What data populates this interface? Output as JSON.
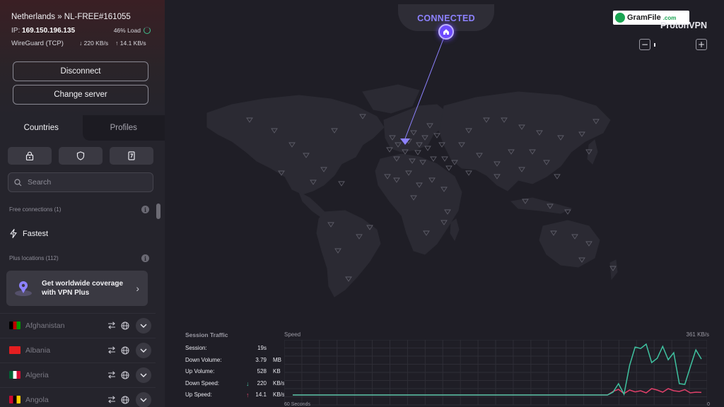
{
  "connection": {
    "server": "Netherlands » NL-FREE#161055",
    "ip_label": "IP:",
    "ip": "169.150.196.135",
    "load": "46% Load",
    "protocol": "WireGuard (TCP)",
    "down_rate": "220 KB/s",
    "up_rate": "14.1 KB/s",
    "disconnect_label": "Disconnect",
    "change_server_label": "Change server"
  },
  "tabs": [
    {
      "label": "Countries",
      "active": true
    },
    {
      "label": "Profiles",
      "active": false
    }
  ],
  "filters": [
    "lock-icon",
    "shield-icon",
    "p2p-icon"
  ],
  "search": {
    "placeholder": "Search"
  },
  "free_section": {
    "label": "Free connections (1)"
  },
  "fastest": {
    "label": "Fastest"
  },
  "plus_section": {
    "label": "Plus locations (112)"
  },
  "upsell": {
    "text": "Get worldwide coverage with VPN Plus"
  },
  "countries": [
    {
      "name": "Afghanistan",
      "flag_colors": [
        "#000000",
        "#be0000",
        "#009900"
      ]
    },
    {
      "name": "Albania",
      "flag_colors": [
        "#e41e20",
        "#e41e20",
        "#e41e20"
      ]
    },
    {
      "name": "Algeria",
      "flag_colors": [
        "#006233",
        "#ffffff",
        "#d21034"
      ]
    },
    {
      "name": "Angola",
      "flag_colors": [
        "#cc092f",
        "#000000",
        "#ffcb00"
      ]
    }
  ],
  "map": {
    "status": "CONNECTED",
    "brand": "ProtonVPN",
    "watermark_name": "GramFile",
    "watermark_domain": ".com",
    "accent": "#6d4aff"
  },
  "traffic": {
    "title": "Session Traffic",
    "stats": [
      {
        "label": "Session:",
        "value": "19s",
        "unit": "",
        "arrow": ""
      },
      {
        "label": "Down Volume:",
        "value": "3.79",
        "unit": "MB",
        "arrow": ""
      },
      {
        "label": "Up Volume:",
        "value": "528",
        "unit": "KB",
        "arrow": ""
      },
      {
        "label": "Down Speed:",
        "value": "220",
        "unit": "KB/s",
        "arrow": "↓"
      },
      {
        "label": "Up Speed:",
        "value": "14.1",
        "unit": "KB/s",
        "arrow": "↑"
      }
    ],
    "speed_label": "Speed",
    "speed_max": "361 KB/s",
    "x_left": "60 Seconds",
    "x_right": "0",
    "down_color": "#3fc2a0",
    "up_color": "#e0406a",
    "down_series": [
      0,
      0,
      0,
      0,
      0,
      0,
      0,
      0,
      0,
      0,
      0,
      0,
      0,
      0,
      0,
      0,
      0,
      0,
      0,
      0,
      0,
      0,
      0,
      0,
      0,
      0,
      0,
      0,
      0,
      0,
      0,
      0,
      0,
      0,
      0,
      0,
      0,
      0,
      0,
      0,
      0,
      0,
      0,
      0,
      0,
      0,
      0,
      0,
      0,
      0,
      0,
      0,
      0,
      0,
      0,
      0,
      0,
      0,
      20,
      80,
      5,
      210,
      340,
      330,
      361,
      230,
      260,
      345,
      250,
      300,
      80,
      75,
      200,
      320,
      255
    ],
    "up_series": [
      0,
      0,
      0,
      0,
      0,
      0,
      0,
      0,
      0,
      0,
      0,
      0,
      0,
      0,
      0,
      0,
      0,
      0,
      0,
      0,
      0,
      0,
      0,
      0,
      0,
      0,
      0,
      0,
      0,
      0,
      0,
      0,
      0,
      0,
      0,
      0,
      0,
      0,
      0,
      0,
      0,
      0,
      0,
      0,
      0,
      0,
      0,
      0,
      0,
      0,
      0,
      0,
      0,
      0,
      0,
      0,
      0,
      0,
      25,
      40,
      10,
      35,
      22,
      30,
      15,
      45,
      35,
      20,
      45,
      30,
      25,
      38,
      15,
      20,
      18
    ]
  }
}
